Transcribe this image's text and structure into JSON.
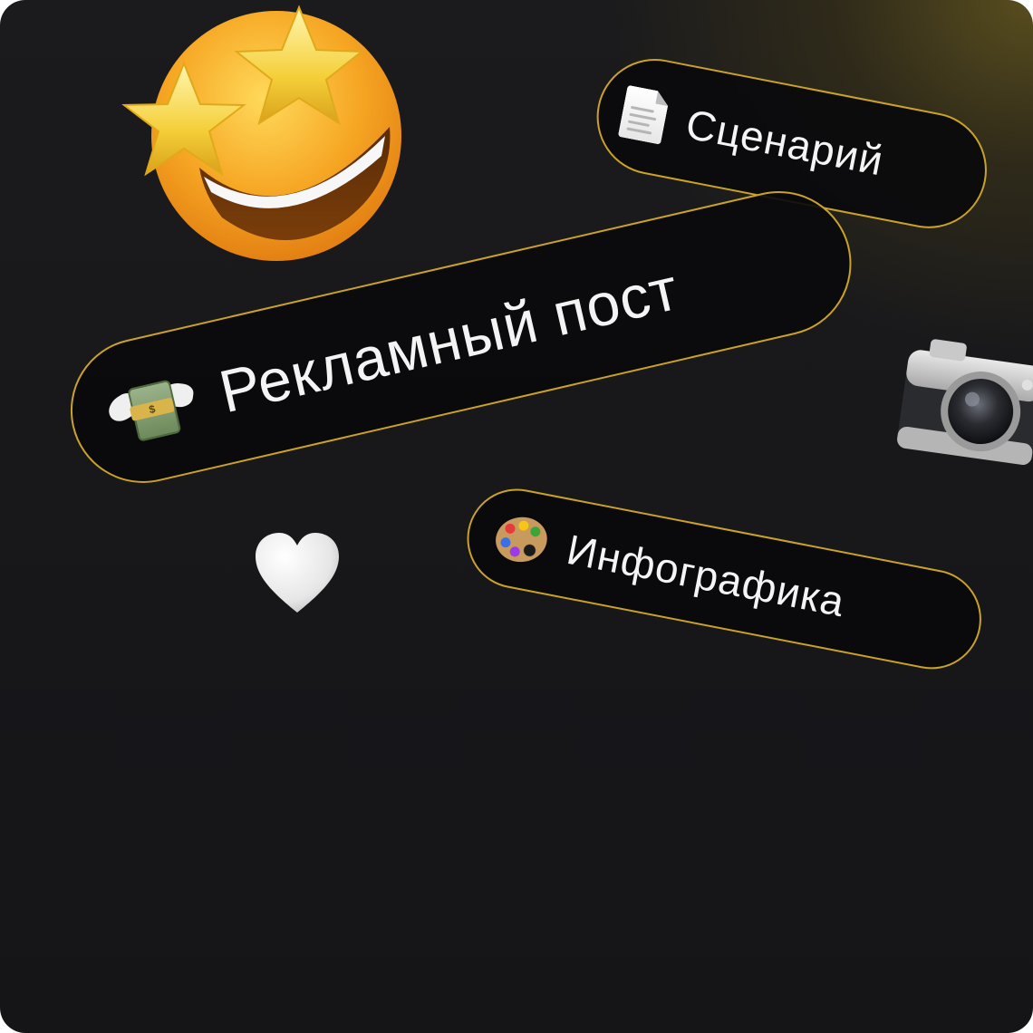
{
  "pills": {
    "scenario": {
      "label": "Сценарий",
      "icon": "page-icon"
    },
    "ad_post": {
      "label": "Рекламный пост",
      "icon": "money-with-wings-icon"
    },
    "infographic": {
      "label": "Инфографика",
      "icon": "artist-palette-icon"
    }
  },
  "decorations": {
    "star_face": "star-struck-emoji",
    "camera": "camera-icon",
    "heart": "white-heart-icon"
  },
  "colors": {
    "background": "#17171a",
    "glow": "#5c501e",
    "accent_border": "#c9a227",
    "pill_fill": "#0a0a0c",
    "text": "#f4f4f4"
  }
}
